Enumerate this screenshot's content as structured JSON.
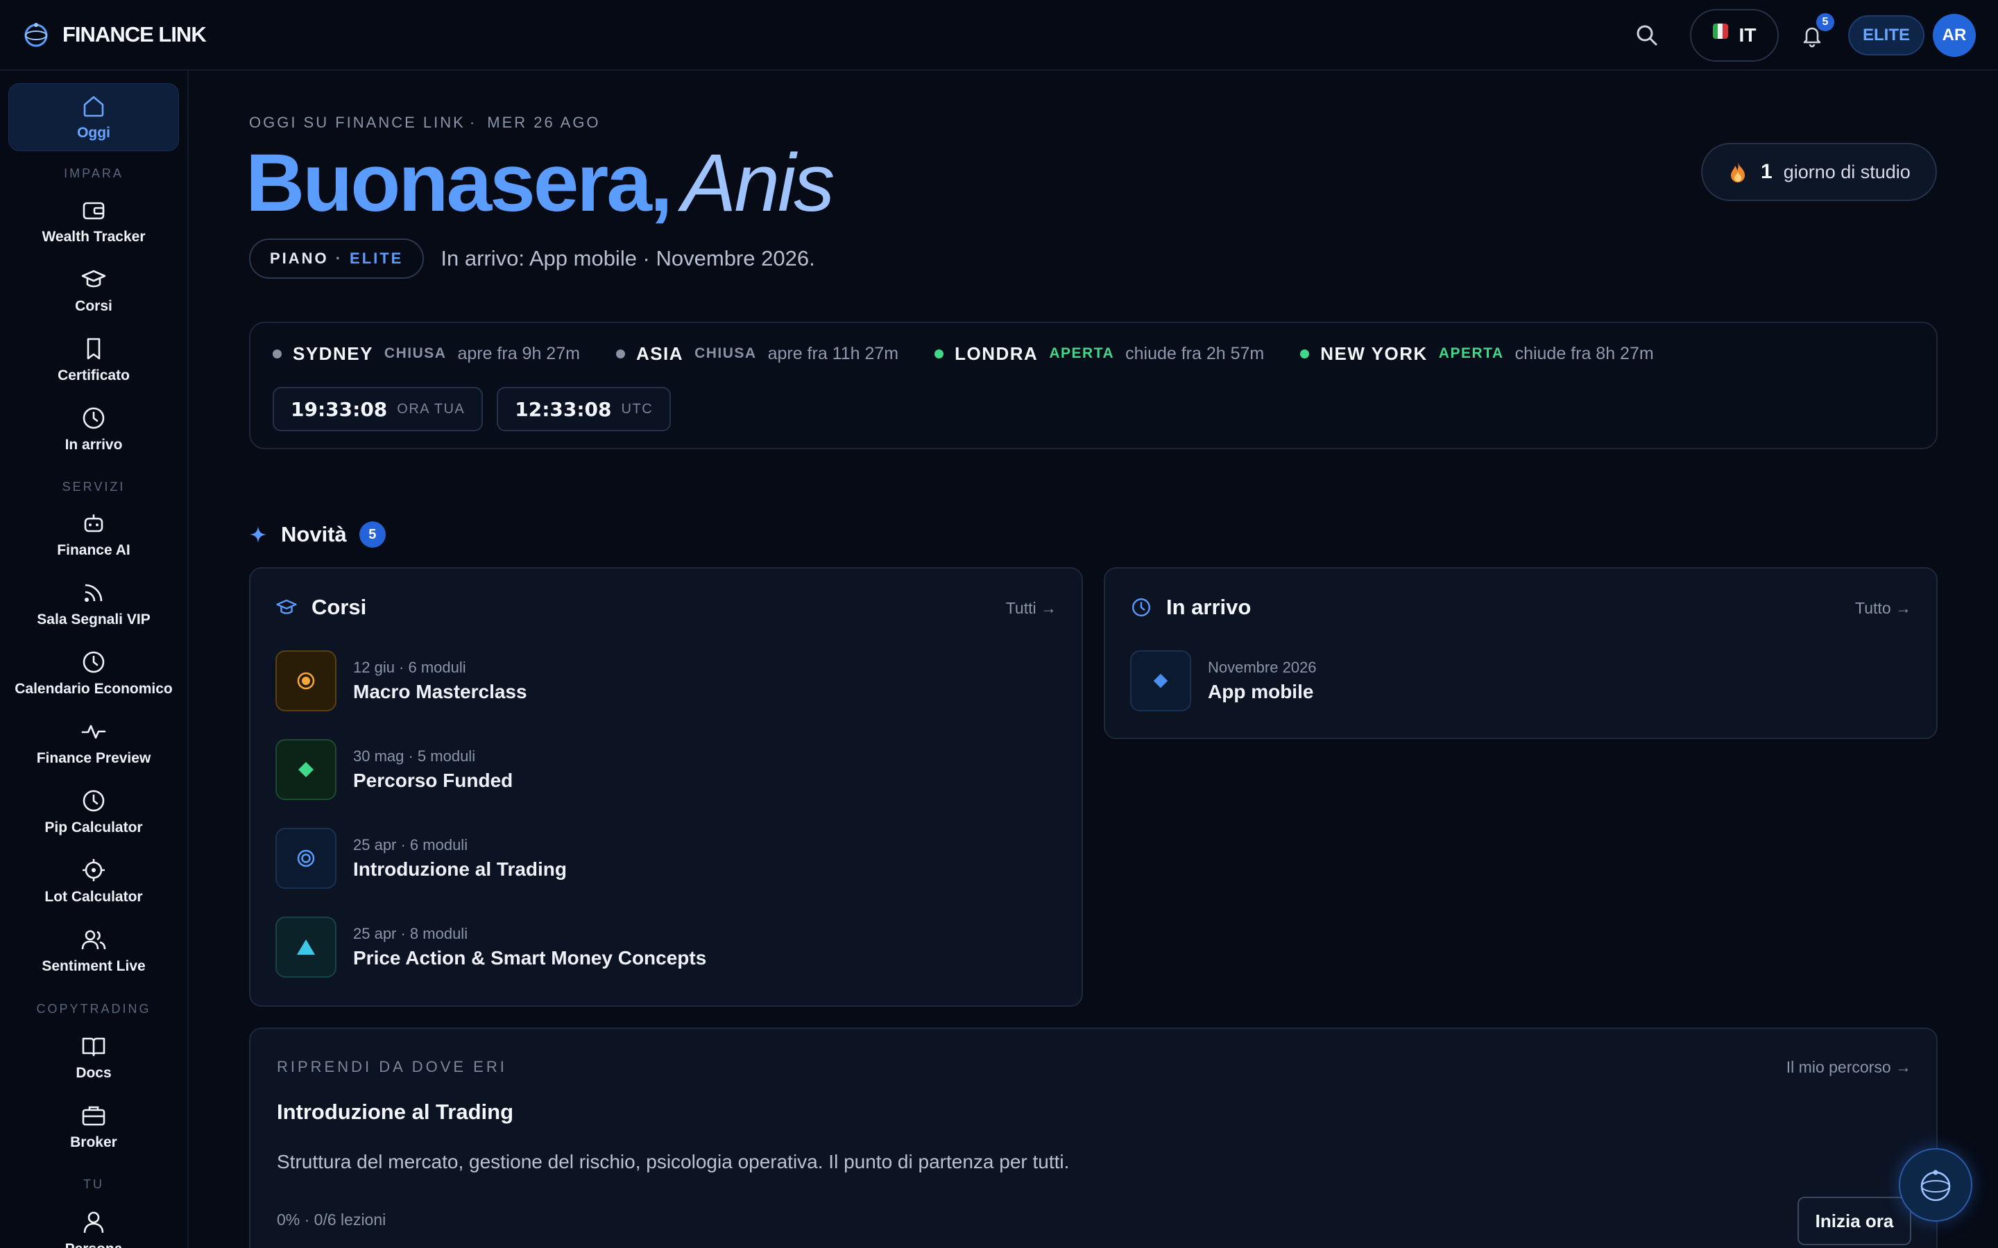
{
  "app": {
    "name": "FINANCE LINK"
  },
  "topbar": {
    "language": "IT",
    "notifications_count": "5",
    "plan_badge": "ELITE",
    "avatar_initials": "AR"
  },
  "sidebar": {
    "home": "Oggi",
    "sections": {
      "learn": "IMPARA",
      "services": "SERVIZI",
      "copytrading": "COPYTRADING",
      "you": "TU"
    },
    "learn_items": [
      "Wealth Tracker",
      "Corsi",
      "Certificato",
      "In arrivo"
    ],
    "service_items": [
      "Finance AI",
      "Sala Segnali VIP",
      "Calendario Economico",
      "Finance Preview",
      "Pip Calculator",
      "Lot Calculator",
      "Sentiment Live"
    ],
    "copytrading_items": [
      "Docs",
      "Broker"
    ],
    "you_items": [
      "Persona"
    ]
  },
  "header": {
    "eyebrow_left": "OGGI SU FINANCE LINK",
    "eyebrow_sep": "·",
    "eyebrow_date": "MER 26 AGO",
    "greeting": "Buonasera,",
    "name": "Anis",
    "plan_label": "PIANO",
    "plan_dot": "·",
    "plan_tier": "ELITE",
    "plan_note": "In arrivo: App mobile · Novembre 2026."
  },
  "streak": {
    "count": "1",
    "label": "giorno di studio"
  },
  "markets": [
    {
      "name": "SYDNEY",
      "status": "CHIUSA",
      "detail": "apre fra 9h 27m",
      "open": false
    },
    {
      "name": "ASIA",
      "status": "CHIUSA",
      "detail": "apre fra 11h 27m",
      "open": false
    },
    {
      "name": "LONDRA",
      "status": "APERTA",
      "detail": "chiude fra 2h 57m",
      "open": true
    },
    {
      "name": "NEW YORK",
      "status": "APERTA",
      "detail": "chiude fra 8h 27m",
      "open": true
    }
  ],
  "clocks": [
    {
      "time": "19:33:08",
      "label": "ORA TUA"
    },
    {
      "time": "12:33:08",
      "label": "UTC"
    }
  ],
  "news": {
    "title": "Novità",
    "count": "5"
  },
  "courses_card": {
    "title": "Corsi",
    "link": "Tutti →",
    "items": [
      {
        "meta": "12 giu · 6 moduli",
        "name": "Macro Masterclass"
      },
      {
        "meta": "30 mag · 5 moduli",
        "name": "Percorso Funded"
      },
      {
        "meta": "25 apr · 6 moduli",
        "name": "Introduzione al Trading"
      },
      {
        "meta": "25 apr · 8 moduli",
        "name": "Price Action & Smart Money Concepts"
      }
    ]
  },
  "upcoming_card": {
    "title": "In arrivo",
    "link": "Tutto →",
    "items": [
      {
        "meta": "Novembre 2026",
        "name": "App mobile"
      }
    ]
  },
  "resume": {
    "eyebrow": "RIPRENDI DA DOVE ERI",
    "link": "Il mio percorso →",
    "title": "Introduzione al Trading",
    "description": "Struttura del mercato, gestione del rischio, psicologia operativa. Il punto di partenza per tutti.",
    "progress_text": "0% · 0/6 lezioni",
    "progress_fraction": 0,
    "button": "Inizia ora"
  },
  "colors": {
    "accent": "#5b9cff",
    "open": "#3fd98a",
    "closed": "#8a93a3",
    "badge": "#2563d8"
  }
}
